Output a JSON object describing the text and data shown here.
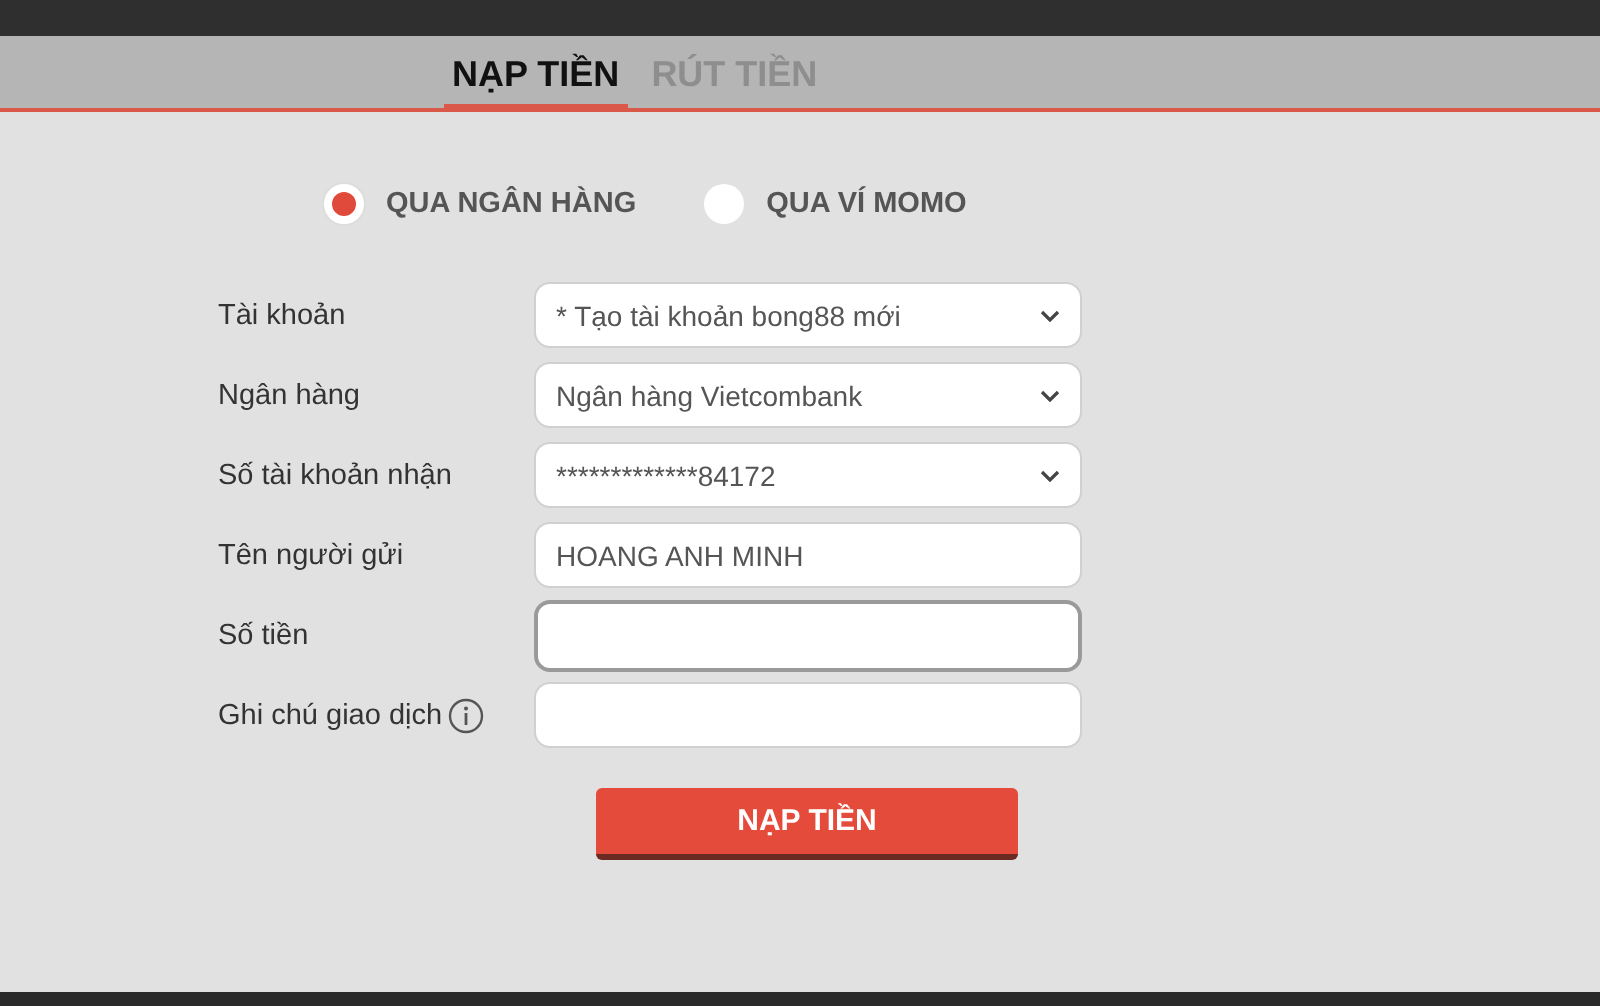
{
  "tabs": [
    {
      "label": "NẠP TIỀN",
      "selected": true
    },
    {
      "label": "RÚT TIỀN",
      "selected": false
    }
  ],
  "methods": [
    {
      "label": "QUA NGÂN HÀNG",
      "selected": true
    },
    {
      "label": "QUA VÍ MOMO",
      "selected": false
    }
  ],
  "fields": [
    {
      "kind": "select",
      "label": "Tài khoản",
      "value": "* Tạo tài khoản bong88 mới"
    },
    {
      "kind": "select",
      "label": "Ngân hàng",
      "value": "Ngân hàng Vietcombank"
    },
    {
      "kind": "select",
      "label": "Số tài khoản nhận",
      "value": "*************84172"
    },
    {
      "kind": "text",
      "label": "Tên người gửi",
      "value": "HOANG ANH MINH"
    },
    {
      "kind": "text",
      "label": "Số tiền",
      "focused": true
    },
    {
      "kind": "text",
      "label": "Ghi chú giao dịch",
      "info": true
    }
  ],
  "submit": "NẠP TIỀN"
}
